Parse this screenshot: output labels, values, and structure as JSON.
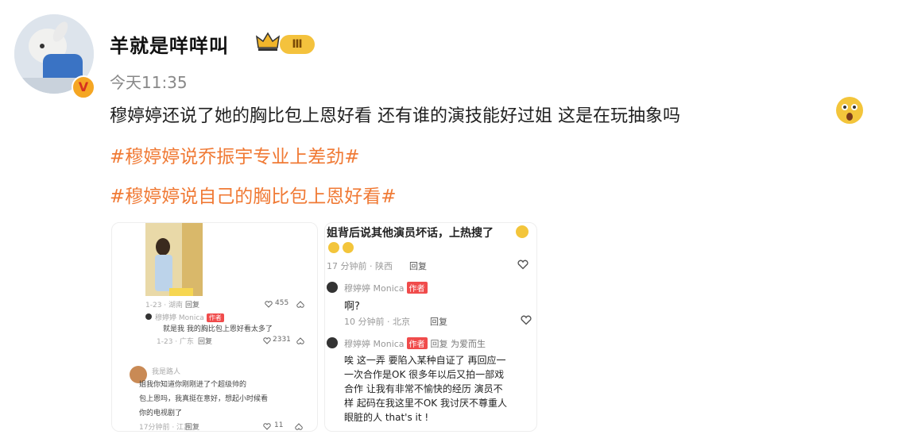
{
  "post": {
    "username": "羊就是咩咩叫",
    "level_badge": "Ⅲ",
    "verified_badge": "V",
    "time": "今天11:35",
    "text": "穆婷婷还说了她的胸比包上恩好看 还有谁的演技能好过姐 这是在玩抽象吗",
    "hashtags": [
      "#穆婷婷说乔振宇专业上差劲#",
      "#穆婷婷说自己的胸比包上恩好看#"
    ]
  },
  "left_shot": {
    "meta1": "1-23 · 湖南",
    "reply1": "回复",
    "likes1": "455",
    "name1": "穆婷婷 Monica",
    "author_tag": "作者",
    "comment1": "就是我 我的胸比包上恩好看太多了",
    "meta2": "1-23 · 广东",
    "reply2": "回复",
    "likes2": "2331",
    "name3": "我是路人",
    "comment3a": "姐我你知道你刚刚进了个超级帅的",
    "comment3b": "包上恩吗，我真挺在意好，想起小时候看",
    "comment3c": "你的电视剧了",
    "meta3": "17分钟前 · 江苏",
    "reply3": "回复",
    "likes3": "11"
  },
  "right_shot": {
    "top_text": "姐背后说其他演员坏话，上热搜了",
    "meta1": "17 分钟前 · 陕西",
    "reply1": "回复",
    "name1": "穆婷婷 Monica",
    "author_tag": "作者",
    "msg1": "啊?",
    "meta2": "10 分钟前 · 北京",
    "reply2": "回复",
    "name2": "穆婷婷 Monica",
    "author_tag2": "作者",
    "reply_to": "回复 为爱而生",
    "msg2_l1": "唉 这一弄 要陷入某种自证了 再回应一",
    "msg2_l2": "一次合作是OK 很多年以后又拍一部戏",
    "msg2_l3": "合作 让我有非常不愉快的经历 演员不",
    "msg2_l4": "样 起码在我这里不OK 我讨厌不尊重人",
    "msg2_l5": "眼脏的人 that's it !"
  }
}
